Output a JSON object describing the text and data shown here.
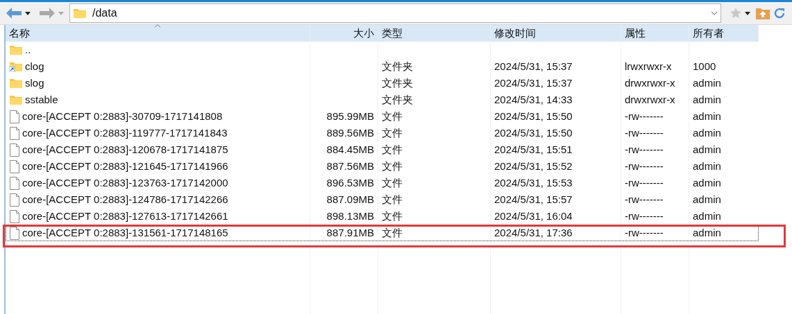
{
  "toolbar": {
    "path": "/data"
  },
  "table": {
    "columns": [
      {
        "label": "名称",
        "sorted": true
      },
      {
        "label": "大小",
        "sorted": false
      },
      {
        "label": "类型",
        "sorted": false
      },
      {
        "label": "修改时间",
        "sorted": false
      },
      {
        "label": "属性",
        "sorted": false
      },
      {
        "label": "所有者",
        "sorted": false
      }
    ],
    "rows": [
      {
        "kind": "parent",
        "name": "..",
        "size": "",
        "type": "",
        "modified": "",
        "attributes": "",
        "owner": "",
        "focused": false,
        "highlighted": false
      },
      {
        "kind": "folder-link",
        "name": "clog",
        "size": "",
        "type": "文件夹",
        "modified": "2024/5/31, 15:37",
        "attributes": "lrwxrwxr-x",
        "owner": "1000",
        "focused": false,
        "highlighted": false
      },
      {
        "kind": "folder",
        "name": "slog",
        "size": "",
        "type": "文件夹",
        "modified": "2024/5/31, 15:37",
        "attributes": "drwxrwxr-x",
        "owner": "admin",
        "focused": false,
        "highlighted": false
      },
      {
        "kind": "folder",
        "name": "sstable",
        "size": "",
        "type": "文件夹",
        "modified": "2024/5/31, 14:33",
        "attributes": "drwxrwxr-x",
        "owner": "admin",
        "focused": false,
        "highlighted": false
      },
      {
        "kind": "file",
        "name": "core-[ACCEPT 0:2883]-30709-1717141808",
        "size": "895.99MB",
        "type": "文件",
        "modified": "2024/5/31, 15:50",
        "attributes": "-rw-------",
        "owner": "admin",
        "focused": false,
        "highlighted": false
      },
      {
        "kind": "file",
        "name": "core-[ACCEPT 0:2883]-119777-1717141843",
        "size": "889.56MB",
        "type": "文件",
        "modified": "2024/5/31, 15:50",
        "attributes": "-rw-------",
        "owner": "admin",
        "focused": false,
        "highlighted": false
      },
      {
        "kind": "file",
        "name": "core-[ACCEPT 0:2883]-120678-1717141875",
        "size": "884.45MB",
        "type": "文件",
        "modified": "2024/5/31, 15:51",
        "attributes": "-rw-------",
        "owner": "admin",
        "focused": false,
        "highlighted": false
      },
      {
        "kind": "file",
        "name": "core-[ACCEPT 0:2883]-121645-1717141966",
        "size": "887.56MB",
        "type": "文件",
        "modified": "2024/5/31, 15:52",
        "attributes": "-rw-------",
        "owner": "admin",
        "focused": false,
        "highlighted": false
      },
      {
        "kind": "file",
        "name": "core-[ACCEPT 0:2883]-123763-1717142000",
        "size": "896.53MB",
        "type": "文件",
        "modified": "2024/5/31, 15:53",
        "attributes": "-rw-------",
        "owner": "admin",
        "focused": false,
        "highlighted": false
      },
      {
        "kind": "file",
        "name": "core-[ACCEPT 0:2883]-124786-1717142266",
        "size": "887.09MB",
        "type": "文件",
        "modified": "2024/5/31, 15:57",
        "attributes": "-rw-------",
        "owner": "admin",
        "focused": false,
        "highlighted": false
      },
      {
        "kind": "file",
        "name": "core-[ACCEPT 0:2883]-127613-1717142661",
        "size": "898.13MB",
        "type": "文件",
        "modified": "2024/5/31, 16:04",
        "attributes": "-rw-------",
        "owner": "admin",
        "focused": false,
        "highlighted": false
      },
      {
        "kind": "file",
        "name": "core-[ACCEPT 0:2883]-131561-1717148165",
        "size": "887.91MB",
        "type": "文件",
        "modified": "2024/5/31, 17:36",
        "attributes": "-rw-------",
        "owner": "admin",
        "focused": true,
        "highlighted": true
      }
    ]
  }
}
